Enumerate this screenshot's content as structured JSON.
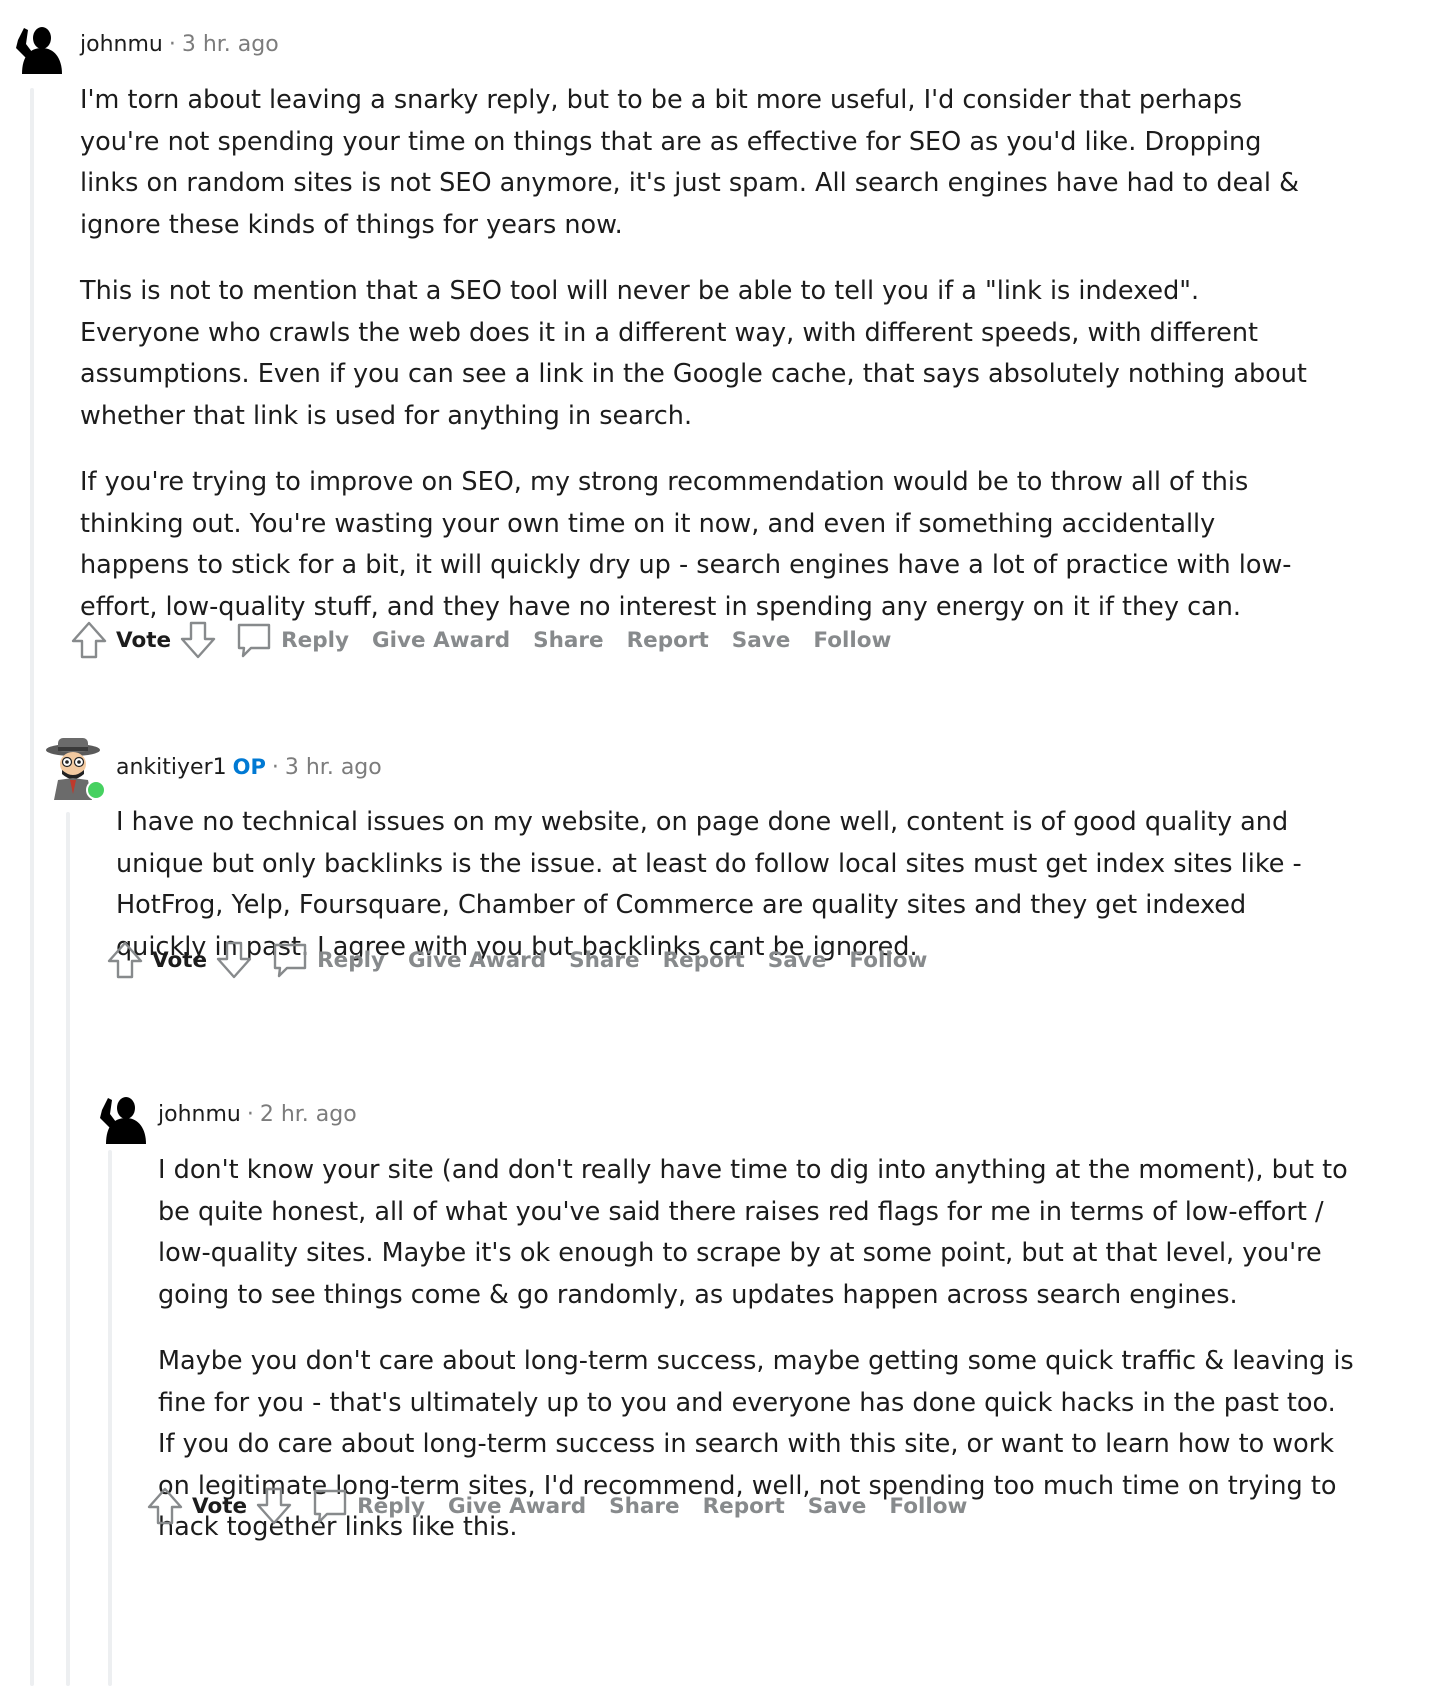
{
  "comments": [
    {
      "author": "johnmu",
      "op_badge": "",
      "separator": "·",
      "time": "3 hr. ago",
      "avatar_icon": "silhouette-waving-avatar-icon",
      "paragraphs": [
        "I'm torn about leaving a snarky reply, but to be a bit more useful, I'd consider that perhaps you're not spending your time on things that are as effective for SEO as you'd like. Dropping links on random sites is not SEO anymore, it's just spam. All search engines have had to deal & ignore these kinds of things for years now.",
        "This is not to mention that a SEO tool will never be able to tell you if a \"link is indexed\". Everyone who crawls the web does it in a different way, with different speeds, with different assumptions. Even if you can see a link in the Google cache, that says absolutely nothing about whether that link is used for anything in search.",
        "If you're trying to improve on SEO, my strong recommendation would be to throw all of this thinking out. You're wasting your own time on it now, and even if something accidentally happens to stick for a bit, it will quickly dry up - search engines have a lot of practice with low-effort, low-quality stuff, and they have no interest in spending any energy on it if they can."
      ]
    },
    {
      "author": "ankitiyer1",
      "op_badge": "OP",
      "separator": "·",
      "time": "3 hr. ago",
      "avatar_icon": "detective-cartoon-avatar-icon",
      "paragraphs": [
        "I have no technical issues on my website, on page done well, content is of good quality and unique but only backlinks is the issue. at least do follow local sites must get index sites like - HotFrog, Yelp, Foursquare, Chamber of Commerce are quality sites and they get indexed quickly in past. I agree with you but backlinks cant be ignored."
      ]
    },
    {
      "author": "johnmu",
      "op_badge": "",
      "separator": "·",
      "time": "2 hr. ago",
      "avatar_icon": "silhouette-waving-avatar-icon",
      "paragraphs": [
        "I don't know your site (and don't really have time to dig into anything at the moment), but to be quite honest, all of what you've said there raises red flags for me in terms of low-effort / low-quality sites. Maybe it's ok enough to scrape by at some point, but at that level, you're going to see things come & go randomly, as updates happen across search engines.",
        "Maybe you don't care about long-term success, maybe getting some quick traffic & leaving is fine for you - that's ultimately up to you and everyone has done quick hacks in the past too. If you do care about long-term success in search with this site, or want to learn how to work on legitimate long-term sites, I'd recommend, well, not spending too much time on trying to hack together links like this."
      ]
    }
  ],
  "actions": {
    "vote": "Vote",
    "reply": "Reply",
    "give_award": "Give Award",
    "share": "Share",
    "report": "Report",
    "save": "Save",
    "follow": "Follow"
  },
  "colors": {
    "text": "#1c1c1c",
    "meta": "#7c7c7c",
    "action": "#878a8c",
    "op_badge": "#0079d3",
    "thread_line": "#edeff1",
    "online": "#46d160"
  }
}
